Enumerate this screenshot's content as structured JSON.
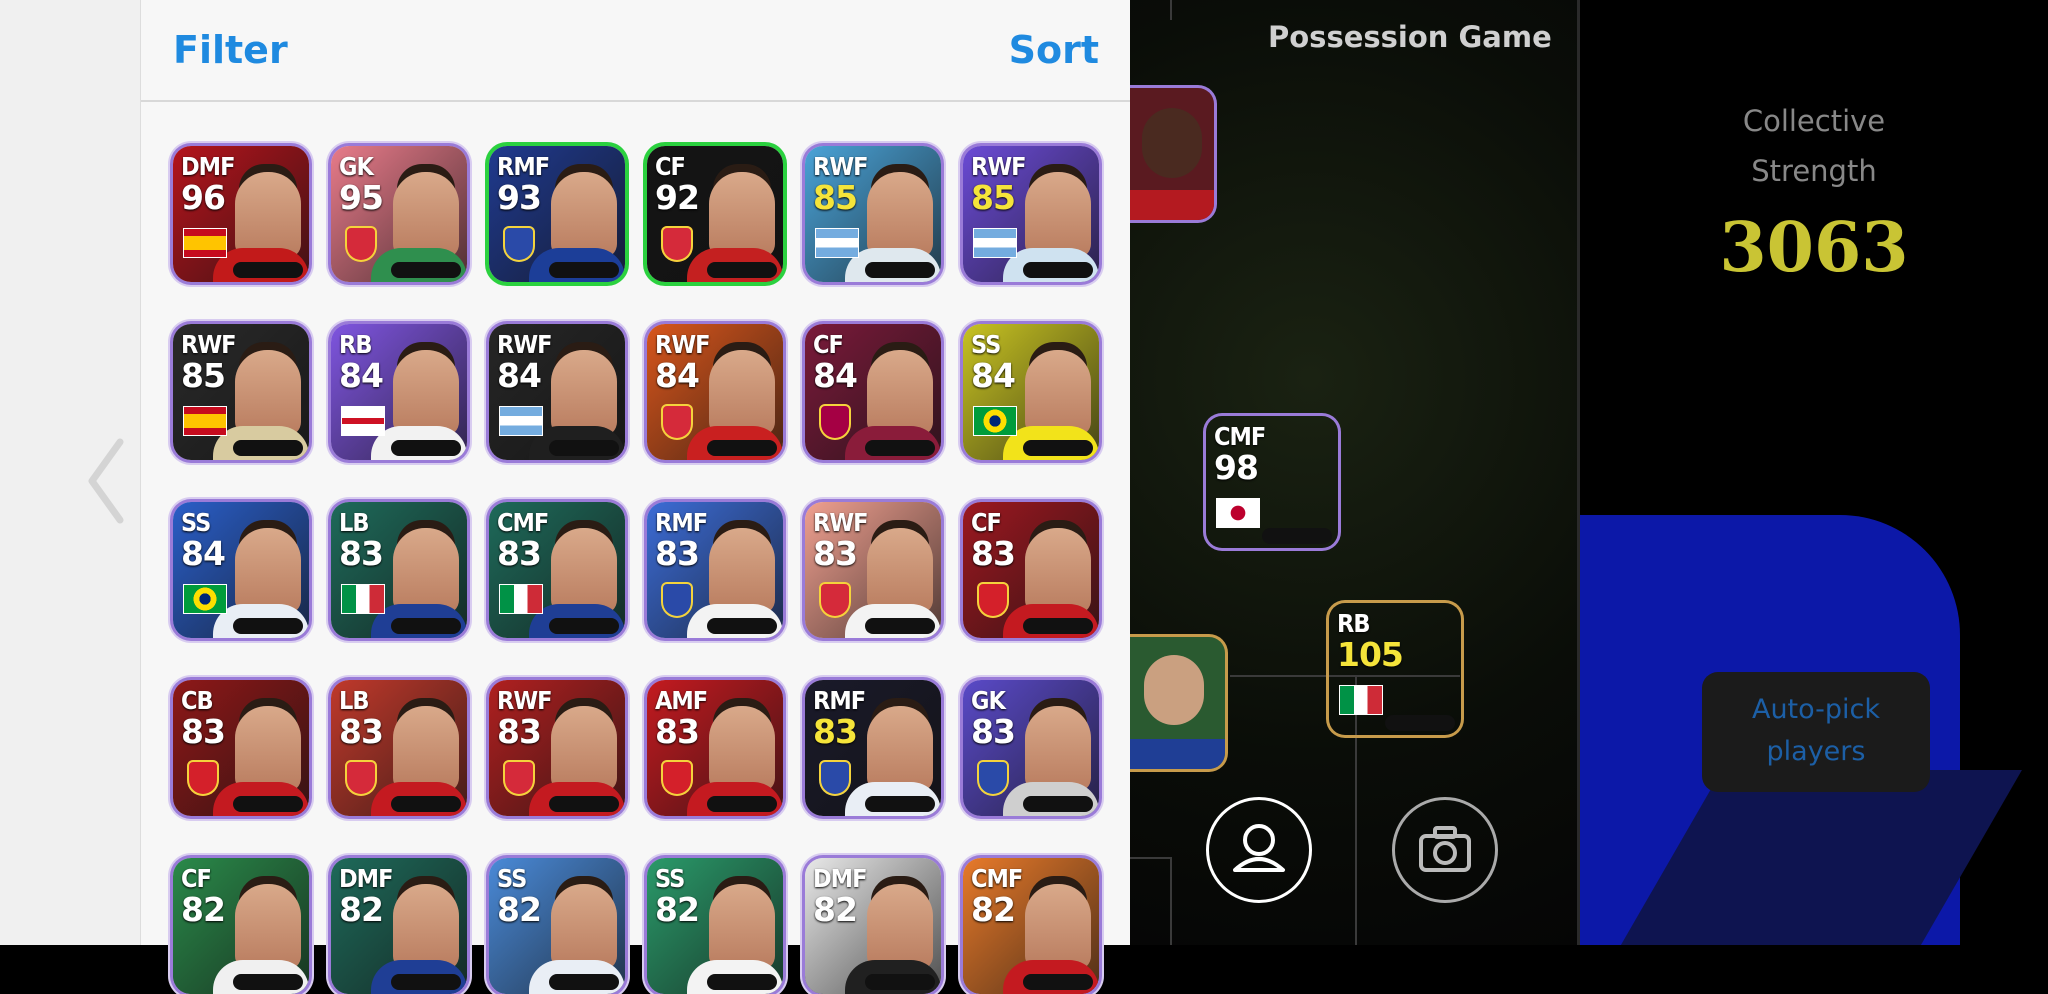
{
  "header": {
    "filter_label": "Filter",
    "sort_label": "Sort"
  },
  "players": [
    {
      "pos": "DMF",
      "rating": "96",
      "color": "#b5141c",
      "shirt": "#c21a1a",
      "flag": "es"
    },
    {
      "pos": "GK",
      "rating": "95",
      "color": "#e87b8a",
      "shirt": "#2f8f4e",
      "flag": "badge-red"
    },
    {
      "pos": "RMF",
      "rating": "93",
      "color": "#203a8f",
      "shirt": "#1c3e98",
      "flag": "badge-blue",
      "border": "green"
    },
    {
      "pos": "CF",
      "rating": "92",
      "color": "#151515",
      "shirt": "#c42020",
      "flag": "badge-red",
      "border": "green"
    },
    {
      "pos": "RWF",
      "rating": "85",
      "gold": true,
      "color": "#4aa3d8",
      "shirt": "#dfe8ee",
      "flag": "ar"
    },
    {
      "pos": "RWF",
      "rating": "85",
      "gold": true,
      "color": "#6b4bd6",
      "shirt": "#cfe2f0",
      "flag": "ar"
    },
    {
      "pos": "RWF",
      "rating": "85",
      "color": "#2a2a2a",
      "shirt": "#d8cba0",
      "flag": "es"
    },
    {
      "pos": "RB",
      "rating": "84",
      "color": "#7f55e0",
      "shirt": "#f2f2f2",
      "flag": "en"
    },
    {
      "pos": "RWF",
      "rating": "84",
      "color": "#262626",
      "shirt": "#1f1f1f",
      "flag": "ar"
    },
    {
      "pos": "RWF",
      "rating": "84",
      "color": "#d8561c",
      "shirt": "#c92020",
      "flag": "badge-red"
    },
    {
      "pos": "CF",
      "rating": "84",
      "color": "#7a1a3a",
      "shirt": "#8a1c3a",
      "flag": "badge-fcb"
    },
    {
      "pos": "SS",
      "rating": "84",
      "color": "#c8c322",
      "shirt": "#f2e31a",
      "flag": "br"
    },
    {
      "pos": "SS",
      "rating": "84",
      "color": "#2a5ec8",
      "shirt": "#e9eef5",
      "flag": "br"
    },
    {
      "pos": "LB",
      "rating": "83",
      "color": "#1e6a5a",
      "shirt": "#1f3e95",
      "flag": "it"
    },
    {
      "pos": "CMF",
      "rating": "83",
      "color": "#1e6a5a",
      "shirt": "#1f3e95",
      "flag": "it"
    },
    {
      "pos": "RMF",
      "rating": "83",
      "color": "#3c6cd6",
      "shirt": "#f3f3f3",
      "flag": "badge-blue"
    },
    {
      "pos": "RWF",
      "rating": "83",
      "color": "#f0a090",
      "shirt": "#f3f3f3",
      "flag": "badge-red"
    },
    {
      "pos": "CF",
      "rating": "83",
      "color": "#9c1820",
      "shirt": "#c41a20",
      "flag": "badge-mu"
    },
    {
      "pos": "CB",
      "rating": "83",
      "color": "#8e1818",
      "shirt": "#c41a20",
      "flag": "badge-mu"
    },
    {
      "pos": "LB",
      "rating": "83",
      "color": "#c0392b",
      "shirt": "#c41a20",
      "flag": "badge-red"
    },
    {
      "pos": "RWF",
      "rating": "83",
      "color": "#b02020",
      "shirt": "#c41a20",
      "flag": "badge-red"
    },
    {
      "pos": "AMF",
      "rating": "83",
      "color": "#c41a20",
      "shirt": "#c41a20",
      "flag": "badge-mu"
    },
    {
      "pos": "RMF",
      "rating": "83",
      "gold": true,
      "color": "#1a1a2a",
      "shirt": "#e9eef5",
      "flag": "badge-blue"
    },
    {
      "pos": "GK",
      "rating": "83",
      "color": "#5a4ac8",
      "shirt": "#cfcfcf",
      "flag": "badge-blue"
    },
    {
      "pos": "CF",
      "rating": "82",
      "color": "#2a8a4a",
      "shirt": "#f0f0f0",
      "flag": ""
    },
    {
      "pos": "DMF",
      "rating": "82",
      "color": "#1e6a5a",
      "shirt": "#1f3e95",
      "flag": ""
    },
    {
      "pos": "SS",
      "rating": "82",
      "color": "#4a8ad8",
      "shirt": "#e9eef5",
      "flag": ""
    },
    {
      "pos": "SS",
      "rating": "82",
      "color": "#2a9a6a",
      "shirt": "#f3f3f3",
      "flag": ""
    },
    {
      "pos": "DMF",
      "rating": "82",
      "color": "#e9e9e9",
      "shirt": "#202020",
      "flag": ""
    },
    {
      "pos": "CMF",
      "rating": "82",
      "color": "#e87a2a",
      "shirt": "#c41a20",
      "flag": ""
    }
  ],
  "field": {
    "title": "Possession Game",
    "players": [
      {
        "pos": "CMF",
        "rating": "98",
        "gold": false,
        "flag": "jp",
        "color": "#2a3a8a",
        "shirt": "#1a2a7a"
      },
      {
        "pos": "RB",
        "rating": "105",
        "gold": true,
        "flag": "it",
        "color": "#3a3a2a",
        "shirt": "#1f3e95"
      }
    ]
  },
  "collective": {
    "label_line1": "Collective",
    "label_line2": "Strength",
    "value": "3063"
  },
  "auto_pick": {
    "line1": "Auto-pick",
    "line2": "players"
  },
  "colors": {
    "accent": "#1f8ae0",
    "strength": "#c9c434"
  }
}
